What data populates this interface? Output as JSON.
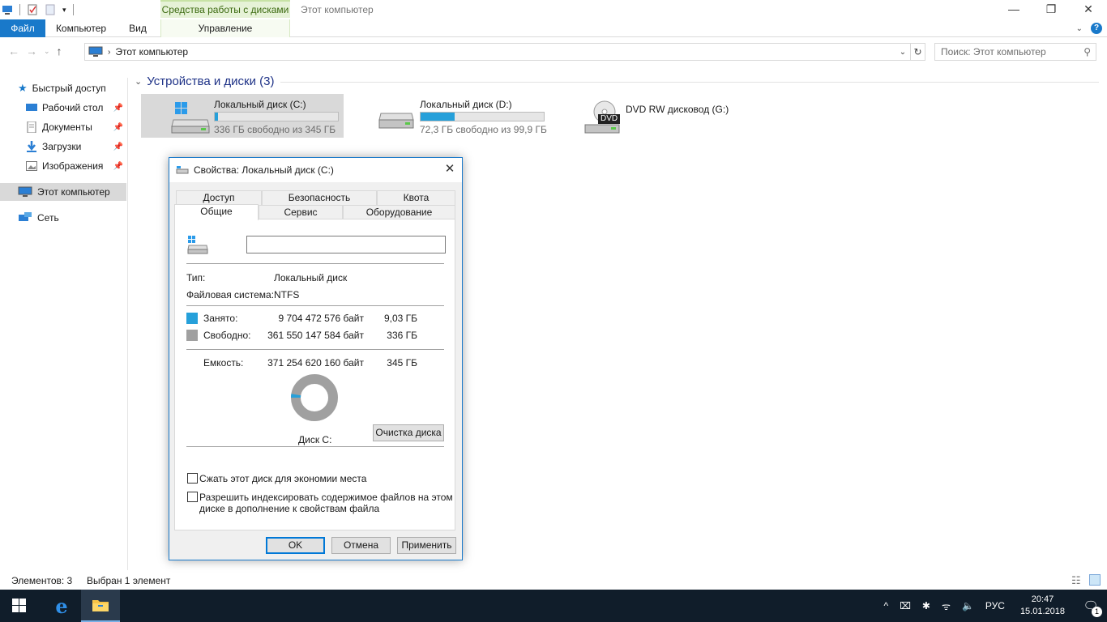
{
  "window": {
    "title": "Этот компьютер",
    "context_tab_header": "Средства работы с дисками",
    "buttons": [
      "—",
      "❐",
      "✕"
    ]
  },
  "ribbon": {
    "tabs": [
      "Файл",
      "Компьютер",
      "Вид",
      "Управление"
    ]
  },
  "address": {
    "path": "Этот компьютер",
    "search_placeholder": "Поиск: Этот компьютер"
  },
  "sidebar": {
    "items": [
      {
        "label": "Быстрый доступ",
        "icon": "star-icon"
      },
      {
        "label": "Рабочий стол",
        "icon": "desktop-icon",
        "pinned": true
      },
      {
        "label": "Документы",
        "icon": "documents-icon",
        "pinned": true
      },
      {
        "label": "Загрузки",
        "icon": "downloads-icon",
        "pinned": true
      },
      {
        "label": "Изображения",
        "icon": "pictures-icon",
        "pinned": true
      },
      {
        "label": "Этот компьютер",
        "icon": "computer-icon",
        "selected": true
      },
      {
        "label": "Сеть",
        "icon": "network-icon"
      }
    ]
  },
  "main": {
    "group_title": "Устройства и диски (3)",
    "drives": [
      {
        "name": "Локальный диск (C:)",
        "free": "336 ГБ свободно из 345 ГБ",
        "used_fraction": 0.026,
        "selected": true
      },
      {
        "name": "Локальный диск (D:)",
        "free": "72,3 ГБ свободно из 99,9 ГБ",
        "used_fraction": 0.276
      },
      {
        "name": "DVD RW дисковод (G:)",
        "badge": "DVD"
      }
    ]
  },
  "status": {
    "items": "Элементов: 3",
    "selected": "Выбран 1 элемент"
  },
  "dialog": {
    "title": "Свойства: Локальный диск (C:)",
    "tabs_back": [
      "Доступ",
      "Безопасность",
      "Квота"
    ],
    "tabs_front": [
      "Общие",
      "Сервис",
      "Оборудование"
    ],
    "label_value": "",
    "type_label": "Тип:",
    "type_value": "Локальный диск",
    "fs_label": "Файловая система:",
    "fs_value": "NTFS",
    "used_label": "Занято:",
    "used_bytes": "9 704 472 576 байт",
    "used_gb": "9,03 ГБ",
    "free_label": "Свободно:",
    "free_bytes": "361 550 147 584 байт",
    "free_gb": "336 ГБ",
    "cap_label": "Емкость:",
    "cap_bytes": "371 254 620 160 байт",
    "cap_gb": "345 ГБ",
    "disk_label": "Диск C:",
    "cleanup_button": "Очистка диска",
    "compress_label": "Сжать этот диск для экономии места",
    "index_label_1": "Разрешить индексировать содержимое файлов на этом",
    "index_label_2": "диске в дополнение к свойствам файла",
    "ok": "OK",
    "cancel": "Отмена",
    "apply": "Применить",
    "used_color": "#26a0da",
    "free_color": "#a0a0a0",
    "used_fraction": 0.026
  },
  "taskbar": {
    "language": "РУС",
    "time": "20:47",
    "date": "15.01.2018",
    "notification_count": "1"
  }
}
